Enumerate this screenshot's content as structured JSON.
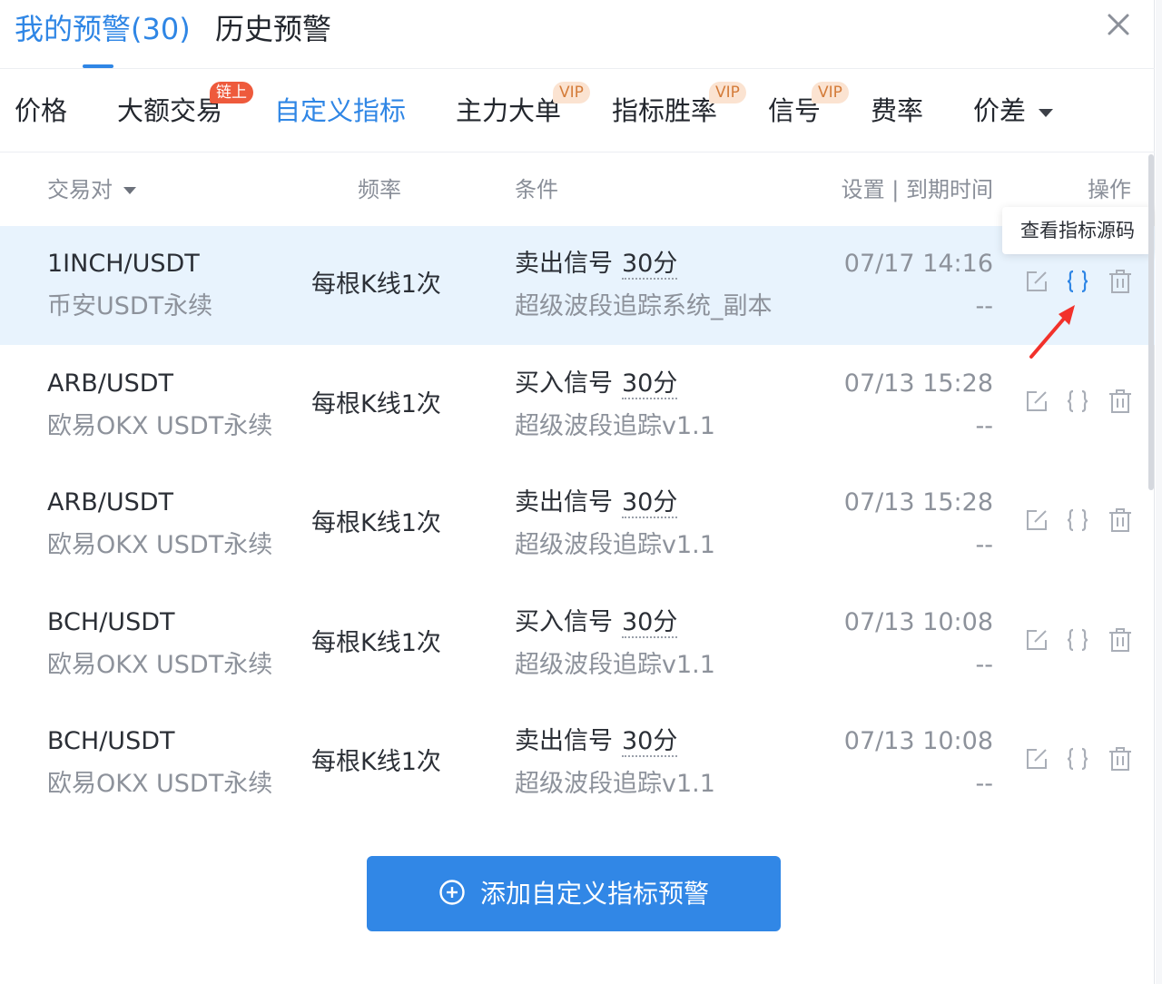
{
  "top_tabs": [
    {
      "label": "我的预警(30)",
      "active": true
    },
    {
      "label": "历史预警",
      "active": false
    }
  ],
  "sub_tabs": [
    {
      "label": "价格"
    },
    {
      "label": "大额交易",
      "badge": "链上"
    },
    {
      "label": "自定义指标",
      "active": true
    },
    {
      "label": "主力大单",
      "badge": "VIP"
    },
    {
      "label": "指标胜率",
      "badge": "VIP"
    },
    {
      "label": "信号",
      "badge": "VIP"
    },
    {
      "label": "费率"
    },
    {
      "label": "价差"
    }
  ],
  "table": {
    "headers": {
      "pair": "交易对",
      "frequency": "频率",
      "condition": "条件",
      "settings": "设置 | 到期时间",
      "actions": "操作"
    },
    "rows": [
      {
        "pair": "1INCH/USDT",
        "exchange": "币安USDT永续",
        "frequency": "每根K线1次",
        "signal": "卖出信号",
        "timeframe": "30分",
        "indicator": "超级波段追踪系统_副本",
        "time": "07/17 14:16",
        "expiry": "--"
      },
      {
        "pair": "ARB/USDT",
        "exchange": "欧易OKX USDT永续",
        "frequency": "每根K线1次",
        "signal": "买入信号",
        "timeframe": "30分",
        "indicator": "超级波段追踪v1.1",
        "time": "07/13 15:28",
        "expiry": "--"
      },
      {
        "pair": "ARB/USDT",
        "exchange": "欧易OKX USDT永续",
        "frequency": "每根K线1次",
        "signal": "卖出信号",
        "timeframe": "30分",
        "indicator": "超级波段追踪v1.1",
        "time": "07/13 15:28",
        "expiry": "--"
      },
      {
        "pair": "BCH/USDT",
        "exchange": "欧易OKX USDT永续",
        "frequency": "每根K线1次",
        "signal": "买入信号",
        "timeframe": "30分",
        "indicator": "超级波段追踪v1.1",
        "time": "07/13 10:08",
        "expiry": "--"
      },
      {
        "pair": "BCH/USDT",
        "exchange": "欧易OKX USDT永续",
        "frequency": "每根K线1次",
        "signal": "卖出信号",
        "timeframe": "30分",
        "indicator": "超级波段追踪v1.1",
        "time": "07/13 10:08",
        "expiry": "--"
      }
    ]
  },
  "tooltip": "查看指标源码",
  "add_button": "添加自定义指标预警",
  "colors": {
    "accent": "#2f86e5",
    "highlight_row": "#e8f3fd",
    "badge_red": "#ee5a3c",
    "badge_vip": "#fbe3d1",
    "arrow": "#f2312b"
  }
}
